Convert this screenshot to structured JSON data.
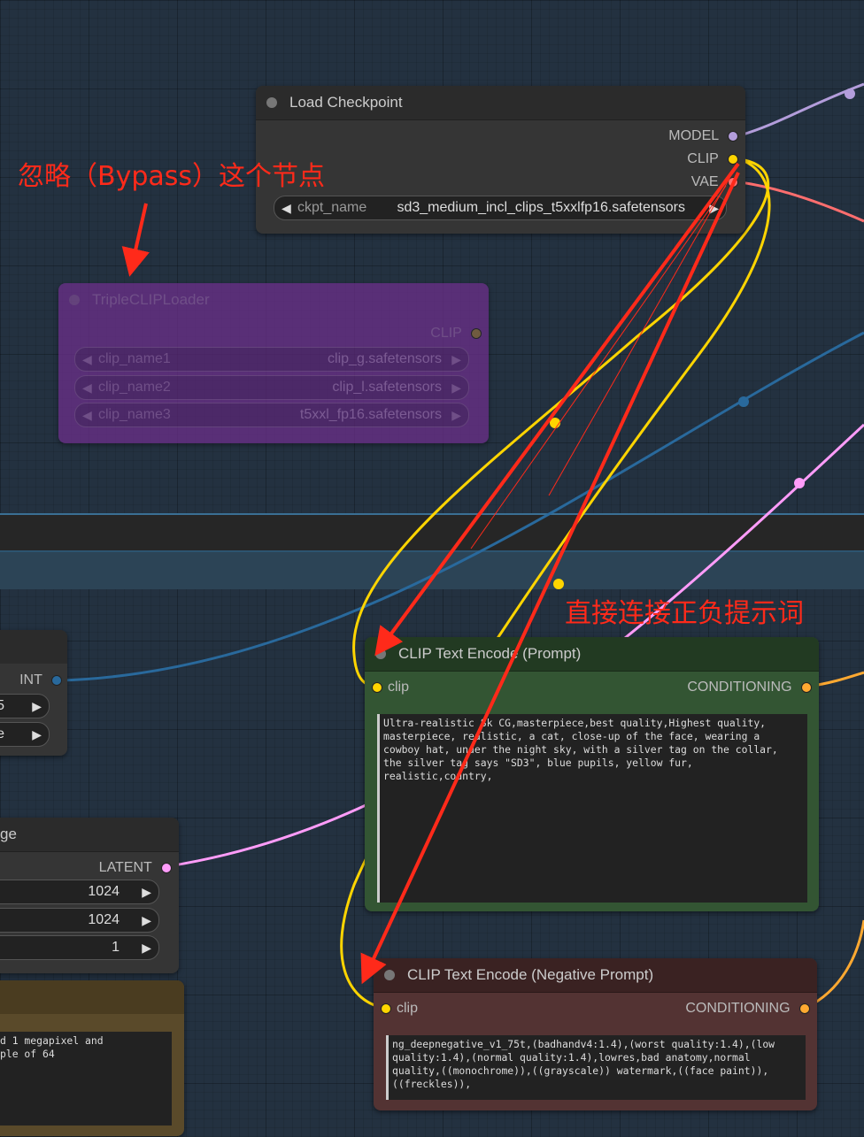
{
  "annotations": {
    "bypass": "忽略（Bypass）这个节点",
    "direct": "直接连接正负提示词"
  },
  "load_checkpoint": {
    "title": "Load Checkpoint",
    "outputs": [
      "MODEL",
      "CLIP",
      "VAE"
    ],
    "widget_label": "ckpt_name",
    "widget_value": "sd3_medium_incl_clips_t5xxlfp16.safetensors"
  },
  "triple_clip": {
    "title": "TripleCLIPLoader",
    "output": "CLIP",
    "widgets": [
      {
        "label": "clip_name1",
        "value": "clip_g.safetensors"
      },
      {
        "label": "clip_name2",
        "value": "clip_l.safetensors"
      },
      {
        "label": "clip_name3",
        "value": "t5xxl_fp16.safetensors"
      }
    ]
  },
  "left_int_node": {
    "output": "INT",
    "widget1_value": "5",
    "widget2_value": "e"
  },
  "latent_node": {
    "title_fragment": "ge",
    "output": "LATENT",
    "widgets": [
      "1024",
      "1024",
      "1"
    ]
  },
  "note_node": {
    "text": "d 1 megapixel and\nple of 64"
  },
  "clip_positive": {
    "title": "CLIP Text Encode (Prompt)",
    "input": "clip",
    "output": "CONDITIONING",
    "text": "Ultra-realistic 8k CG,masterpiece,best quality,Highest quality,\nmasterpiece, realistic, a cat, close-up of the face, wearing a\ncowboy hat, under the night sky, with a silver tag on the collar,\nthe silver tag says \"SD3\", blue pupils, yellow fur,\nrealistic,country,"
  },
  "clip_negative": {
    "title": "CLIP Text Encode (Negative Prompt)",
    "input": "clip",
    "output": "CONDITIONING",
    "text": "ng_deepnegative_v1_75t,(badhandv4:1.4),(worst quality:1.4),(low\nquality:1.4),(normal quality:1.4),lowres,bad anatomy,normal\nquality,((monochrome)),((grayscale)) watermark,((face paint)),\n((freckles)),"
  },
  "colors": {
    "model": "#b39ddb",
    "clip": "#ffd500",
    "vae": "#ff6e6e",
    "int": "#29699c",
    "latent": "#ff9cf9",
    "conditioning": "#ffa931",
    "annotation": "#ff2a1a",
    "positive_node": "#335533",
    "negative_node": "#533333",
    "bypass_node": "#6b2f8a"
  }
}
